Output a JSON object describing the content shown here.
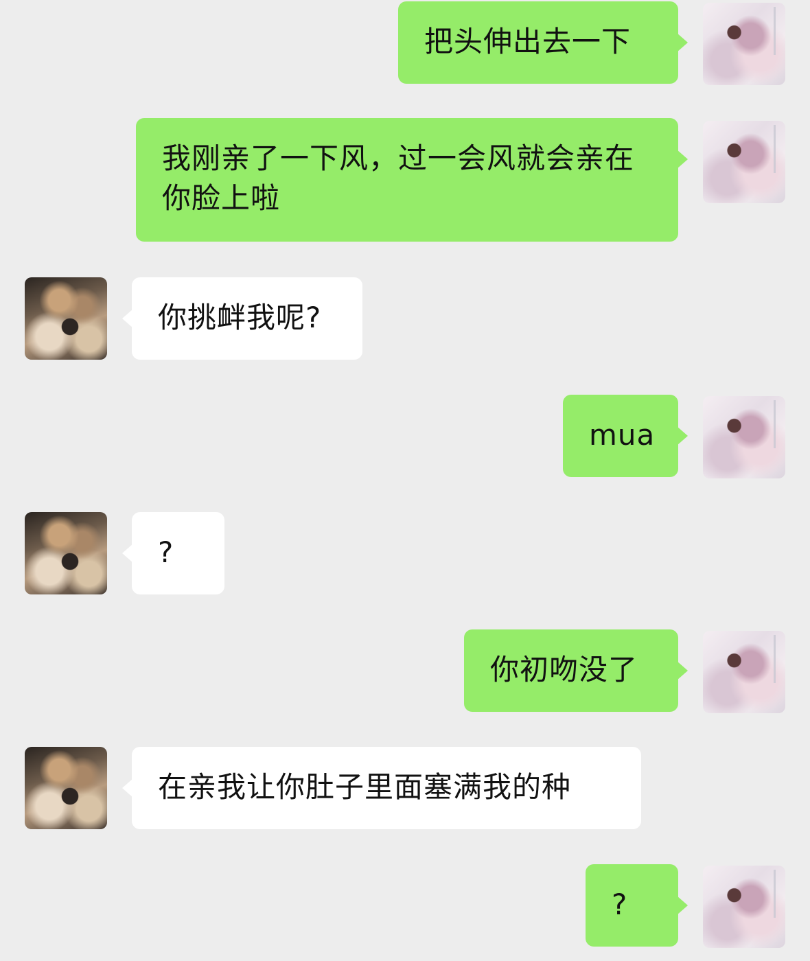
{
  "colors": {
    "background": "#ededed",
    "my_bubble": "#95ec69",
    "their_bubble": "#ffffff",
    "text": "#111111"
  },
  "messages": [
    {
      "sender": "me",
      "text": "把头伸出去一下"
    },
    {
      "sender": "me",
      "text": "我刚亲了一下风，过一会风就会亲在你脸上啦"
    },
    {
      "sender": "them",
      "text": "你挑衅我呢?"
    },
    {
      "sender": "me",
      "text": "mua"
    },
    {
      "sender": "them",
      "text": "?"
    },
    {
      "sender": "me",
      "text": "你初吻没了"
    },
    {
      "sender": "them",
      "text": "在亲我让你肚子里面塞满我的种"
    },
    {
      "sender": "me",
      "text": "?"
    }
  ]
}
